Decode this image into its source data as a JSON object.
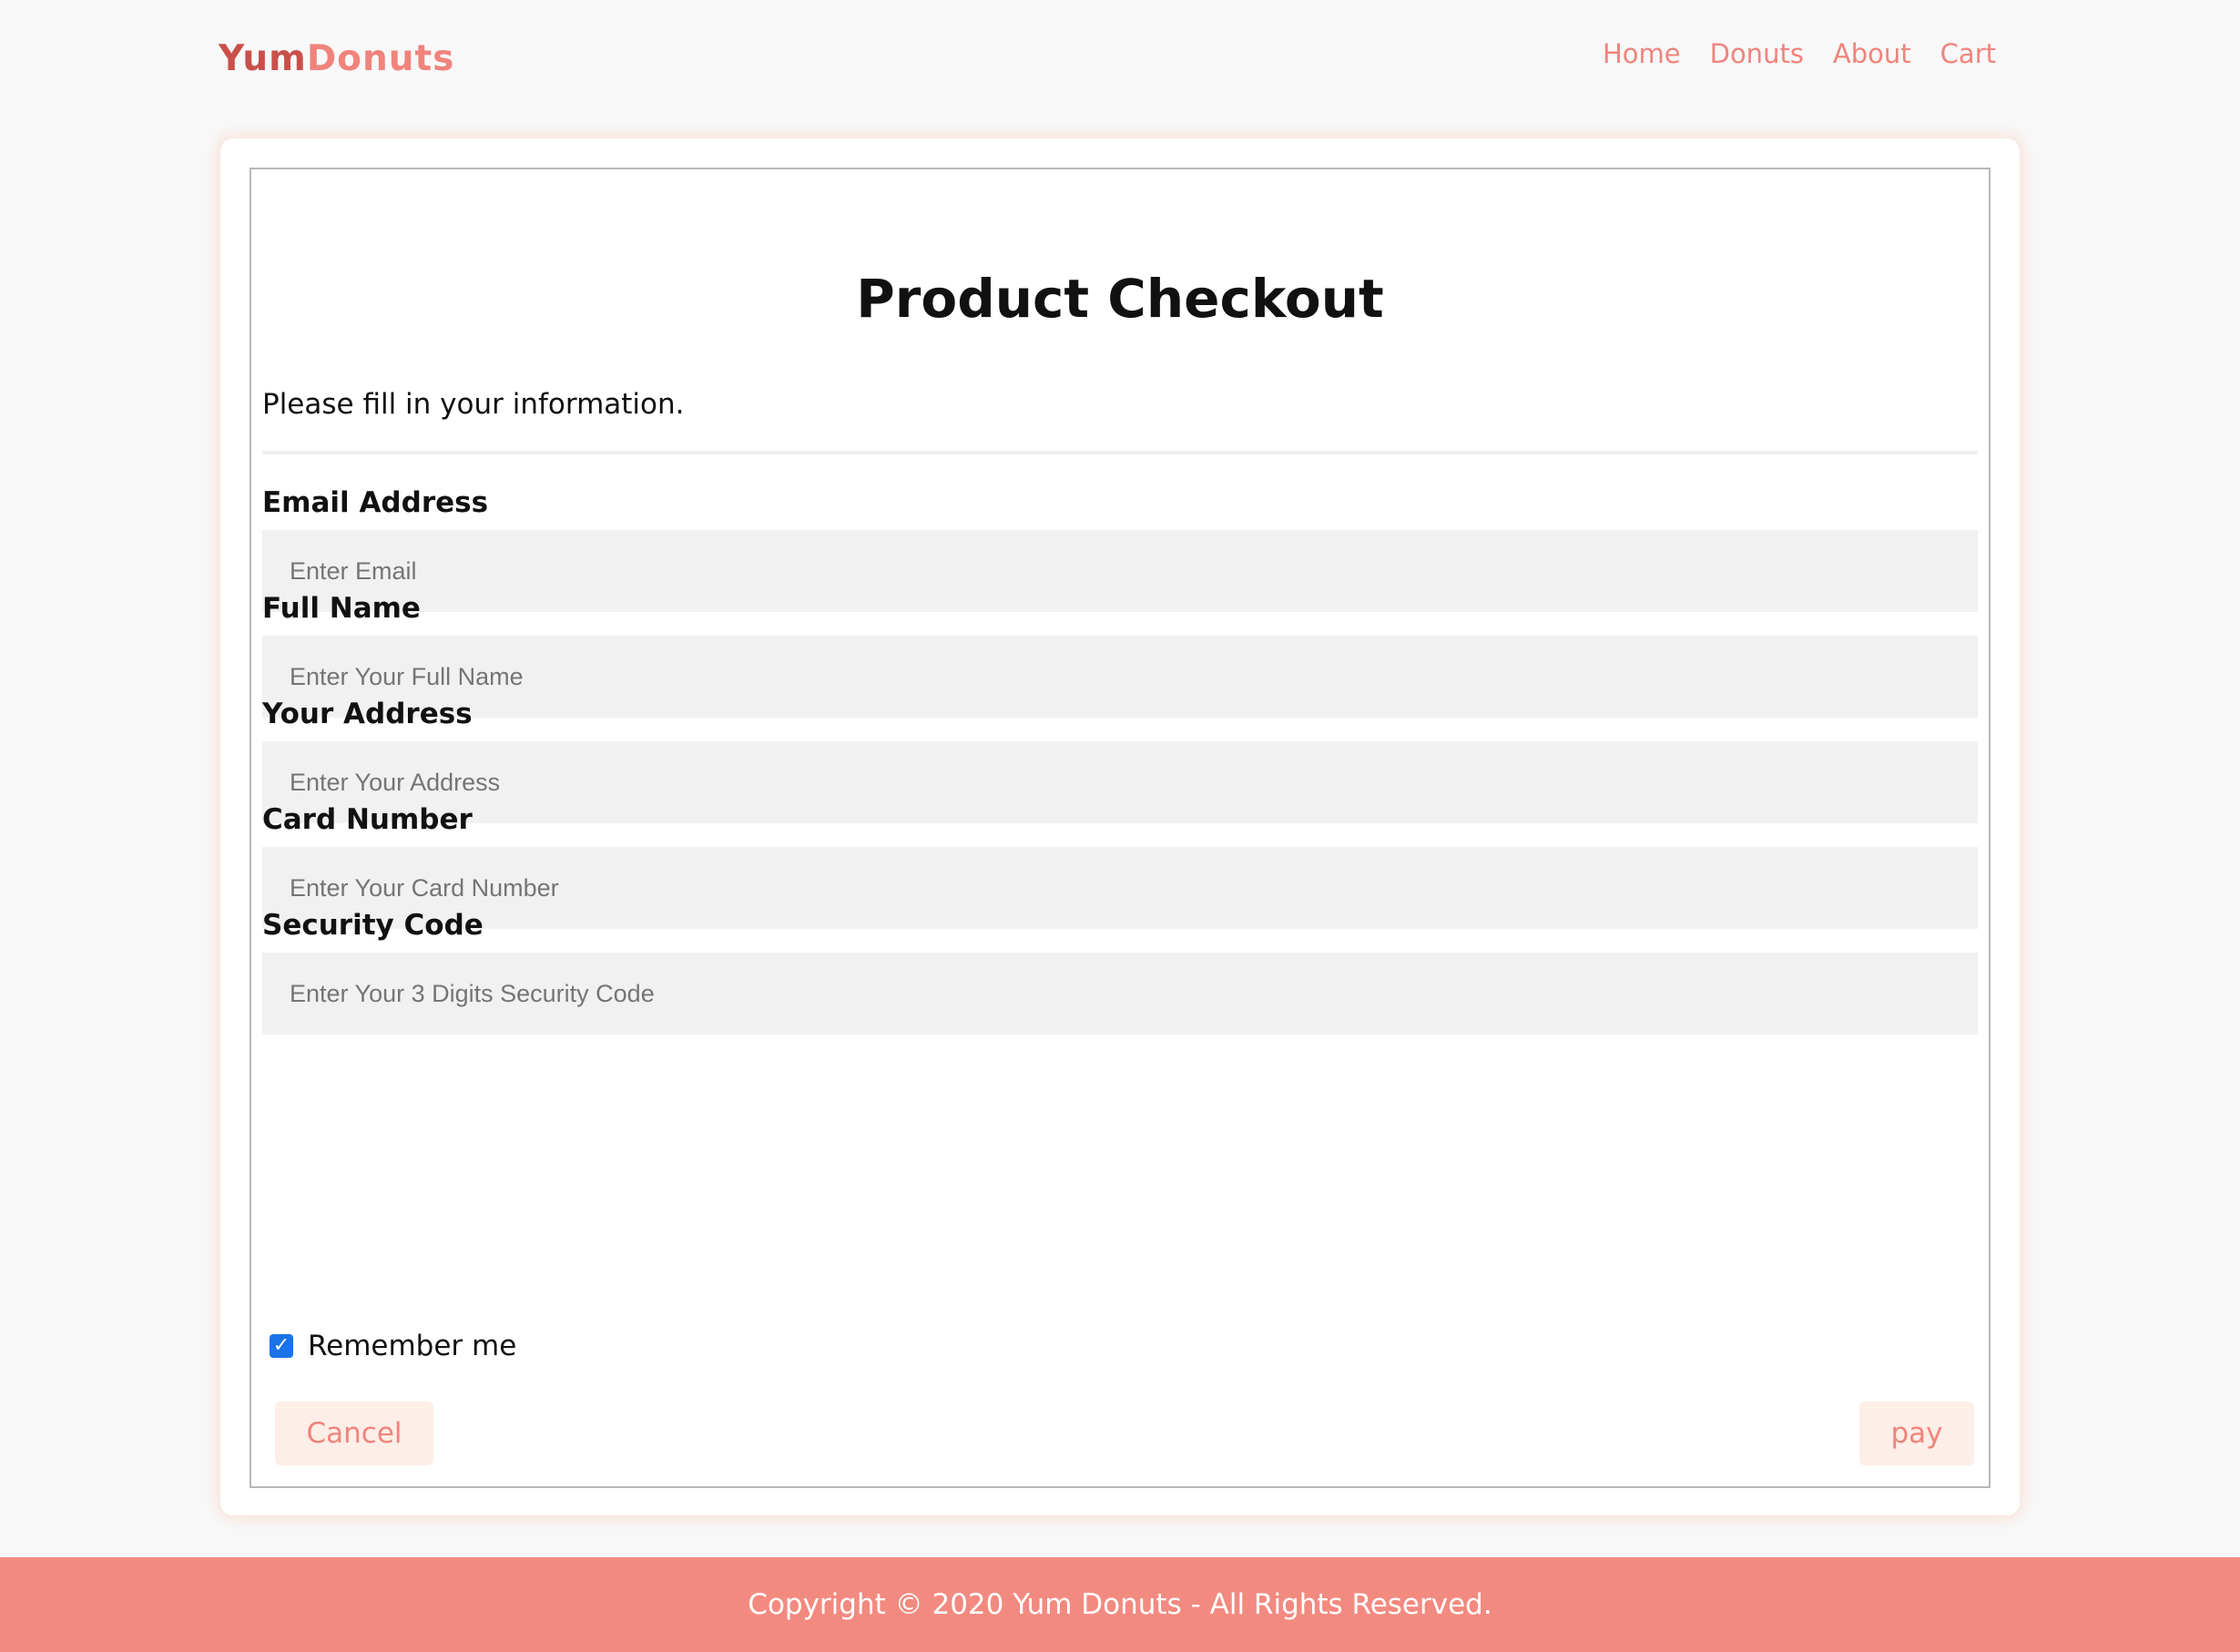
{
  "brand": {
    "part1": "Yum",
    "part2": "Donuts"
  },
  "nav": {
    "items": [
      {
        "label": "Home"
      },
      {
        "label": "Donuts"
      },
      {
        "label": "About"
      },
      {
        "label": "Cart"
      }
    ]
  },
  "checkout": {
    "title": "Product Checkout",
    "intro": "Please fill in your information.",
    "fields": [
      {
        "label": "Email Address",
        "placeholder": "Enter Email",
        "value": ""
      },
      {
        "label": "Full Name",
        "placeholder": "Enter Your Full Name",
        "value": ""
      },
      {
        "label": "Your Address",
        "placeholder": "Enter Your Address",
        "value": ""
      },
      {
        "label": "Card Number",
        "placeholder": "Enter Your Card Number",
        "value": ""
      },
      {
        "label": "Security Code",
        "placeholder": "Enter Your 3 Digits Security Code",
        "value": ""
      }
    ],
    "remember": {
      "label": "Remember me",
      "checked": true
    },
    "cancel_label": "Cancel",
    "pay_label": "pay"
  },
  "footer": {
    "text": "Copyright © 2020 Yum Donuts - All Rights Reserved."
  },
  "colors": {
    "brand_primary": "#f0847c",
    "brand_dark": "#c9504a",
    "footer_bg": "#f28a80",
    "button_bg": "#fdeee7",
    "checkbox": "#1a73e8"
  }
}
